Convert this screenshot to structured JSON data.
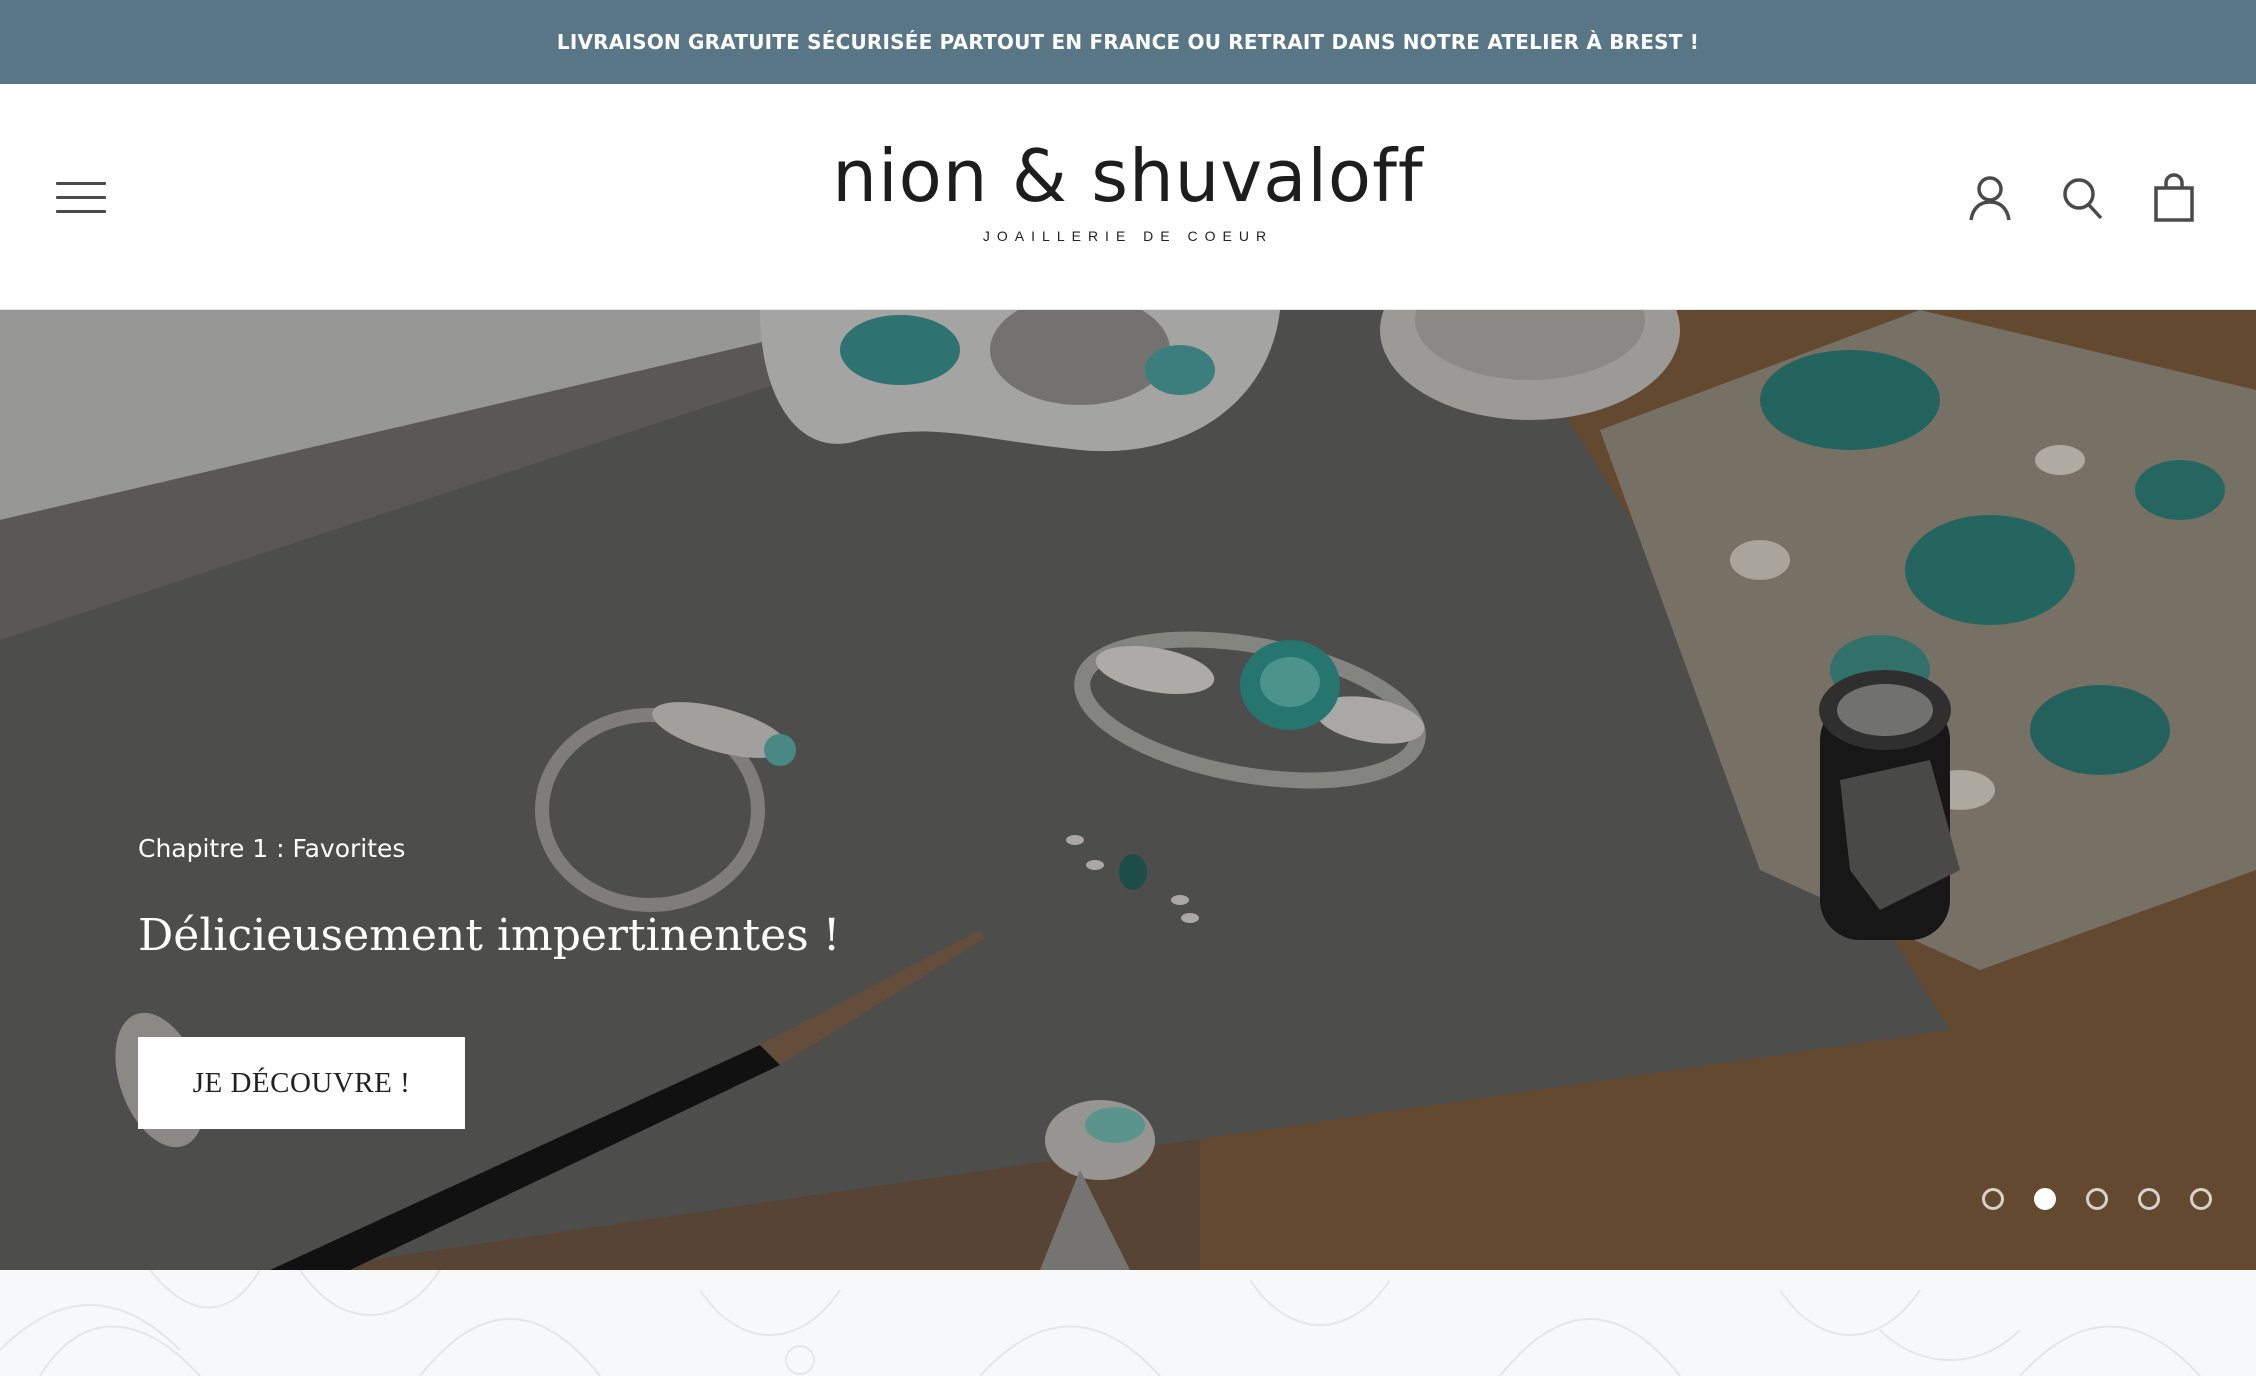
{
  "announcement": {
    "text": "LIVRAISON GRATUITE SÉCURISÉE PARTOUT EN FRANCE OU RETRAIT DANS NOTRE ATELIER À BREST !"
  },
  "header": {
    "logo_main": "nion & shuvaloff",
    "logo_tagline": "JOAILLERIE DE COEUR",
    "icons": [
      "menu-icon",
      "account-icon",
      "search-icon",
      "bag-icon"
    ]
  },
  "hero": {
    "subtitle": "Chapitre 1 : Favorites",
    "title": "Délicieusement impertinentes !",
    "button_label": "JE DÉCOUVRE !",
    "slides_total": 5,
    "active_slide": 2
  },
  "colors": {
    "announcement_bg": "#587685",
    "accent_teal": "#3a9d9a",
    "hero_overlay": "#4e4c4a"
  }
}
